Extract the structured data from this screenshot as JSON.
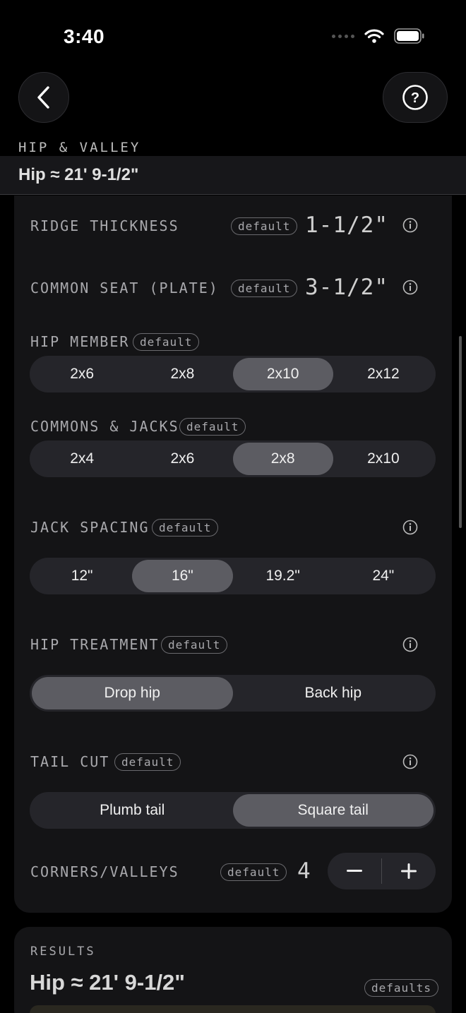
{
  "status_bar": {
    "time": "3:40"
  },
  "header": {
    "section_title": "HIP & VALLEY",
    "summary": "Hip ≈ 21' 9-1/2\""
  },
  "default_tag": "default",
  "ridge_thickness": {
    "label": "RIDGE THICKNESS",
    "value": "1-1/2\""
  },
  "common_seat": {
    "label": "COMMON SEAT (PLATE)",
    "value": "3-1/2\""
  },
  "hip_member": {
    "label": "HIP MEMBER",
    "options": [
      "2x6",
      "2x8",
      "2x10",
      "2x12"
    ],
    "selected": "2x10"
  },
  "commons_jacks": {
    "label": "COMMONS & JACKS",
    "options": [
      "2x4",
      "2x6",
      "2x8",
      "2x10"
    ],
    "selected": "2x8"
  },
  "jack_spacing": {
    "label": "JACK SPACING",
    "options": [
      "12\"",
      "16\"",
      "19.2\"",
      "24\""
    ],
    "selected": "16\""
  },
  "hip_treatment": {
    "label": "HIP TREATMENT",
    "options": [
      "Drop hip",
      "Back hip"
    ],
    "selected": "Drop hip"
  },
  "tail_cut": {
    "label": "TAIL CUT",
    "options": [
      "Plumb tail",
      "Square tail"
    ],
    "selected": "Square tail"
  },
  "corners_valleys": {
    "label": "CORNERS/VALLEYS",
    "value": "4"
  },
  "results": {
    "label": "RESULTS",
    "value": "Hip ≈ 21' 9-1/2\"",
    "tag": "defaults"
  },
  "colors": {
    "background": "#000000",
    "card": "#141416",
    "segment_track": "#25252a",
    "segment_selected": "#5c5c62"
  }
}
